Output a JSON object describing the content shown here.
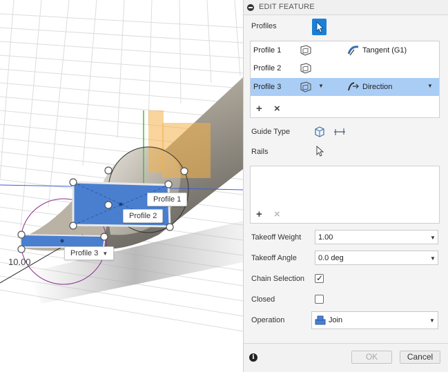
{
  "viewport": {
    "dimension_value": "10.00",
    "tags": {
      "profile1": "Profile 1",
      "profile2": "Profile 2",
      "profile3": "Profile 3"
    }
  },
  "panel": {
    "title": "EDIT FEATURE",
    "profiles_label": "Profiles",
    "profiles": [
      {
        "name": "Profile 1",
        "continuity": "Tangent (G1)"
      },
      {
        "name": "Profile 2",
        "continuity": ""
      },
      {
        "name": "Profile 3",
        "continuity": "Direction"
      }
    ],
    "guide_type_label": "Guide Type",
    "rails_label": "Rails",
    "takeoff_weight_label": "Takeoff Weight",
    "takeoff_weight_value": "1.00",
    "takeoff_angle_label": "Takeoff Angle",
    "takeoff_angle_value": "0.0 deg",
    "chain_selection_label": "Chain Selection",
    "chain_selection_checked": true,
    "closed_label": "Closed",
    "closed_checked": false,
    "operation_label": "Operation",
    "operation_value": "Join",
    "ok_label": "OK",
    "cancel_label": "Cancel"
  },
  "colors": {
    "accent": "#1a7fd6",
    "selected_row": "#a9cdf5",
    "profile_fill": "#4a7fd0",
    "plane_orange": "#f4b04a"
  }
}
